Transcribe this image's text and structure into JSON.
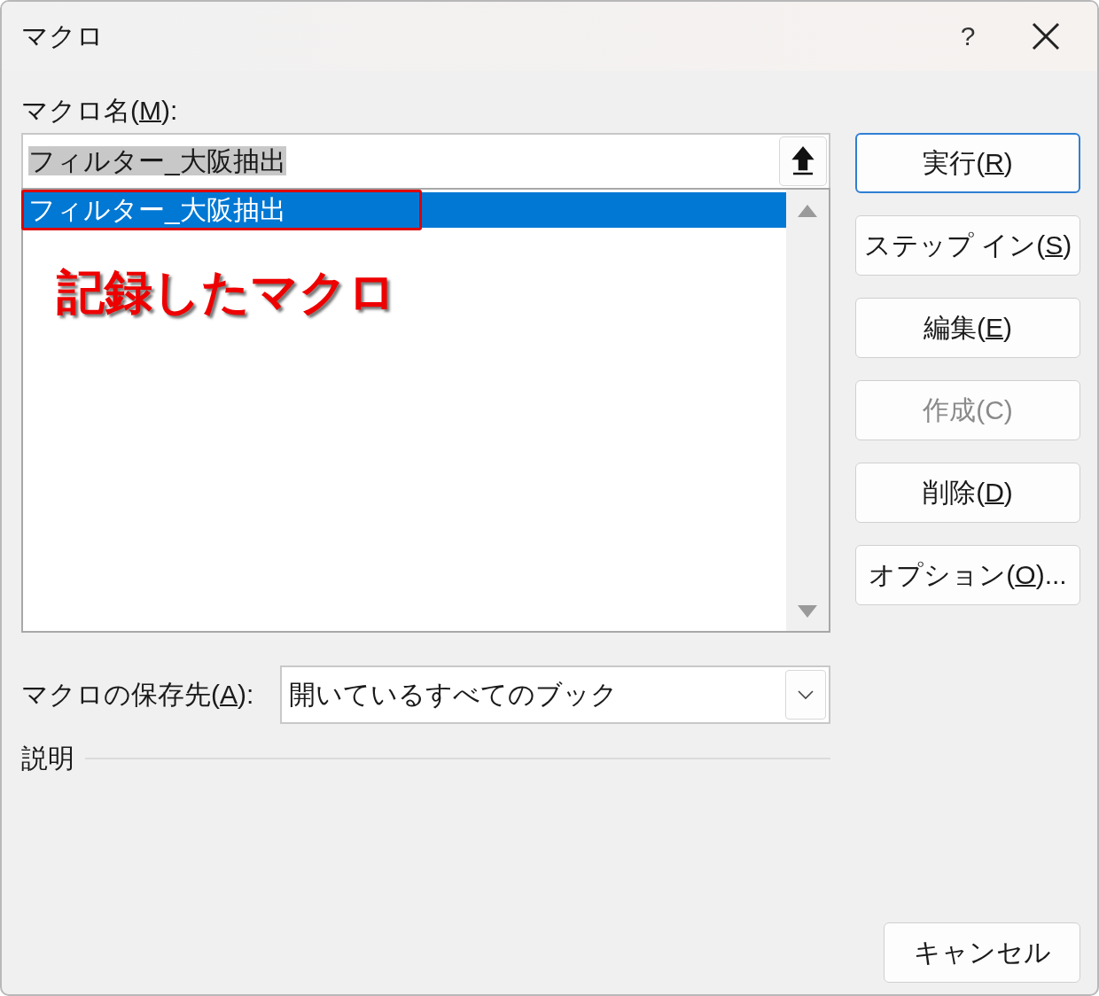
{
  "window": {
    "title": "マクロ",
    "help": "?"
  },
  "macro_name": {
    "label": {
      "before": "マクロ名(",
      "key": "M",
      "after": "):"
    },
    "value": "フィルター_大阪抽出"
  },
  "macro_list": {
    "items": [
      {
        "text": "フィルター_大阪抽出",
        "selected": true,
        "annotated": true
      }
    ]
  },
  "annotation": "記録したマクロ",
  "buttons": [
    {
      "before": "実行(",
      "key": "R",
      "after": ")",
      "default": true,
      "disabled": false
    },
    {
      "before": "ステップ イン(",
      "key": "S",
      "after": ")",
      "default": false,
      "disabled": false
    },
    {
      "before": "編集(",
      "key": "E",
      "after": ")",
      "default": false,
      "disabled": false
    },
    {
      "before": "作成(C)",
      "default": false,
      "disabled": true
    },
    {
      "before": "削除(",
      "key": "D",
      "after": ")",
      "default": false,
      "disabled": false
    },
    {
      "before": "オプション(",
      "key": "O",
      "after": ")...",
      "default": false,
      "disabled": false
    }
  ],
  "macros_in": {
    "label": {
      "before": "マクロの保存先(",
      "key": "A",
      "after": "):"
    },
    "value": "開いているすべてのブック"
  },
  "description": {
    "label": "説明"
  },
  "cancel": "キャンセル"
}
